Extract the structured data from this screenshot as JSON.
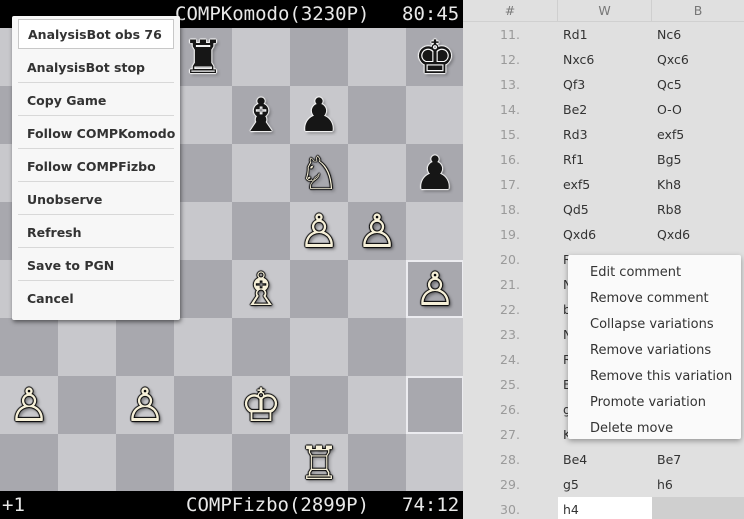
{
  "top_bar": {
    "left_text": "",
    "player": "COMPKomodo(3230P)",
    "clock": "80:45"
  },
  "bottom_bar": {
    "left_text": "+1",
    "player": "COMPFizbo(2899P)",
    "clock": "74:12"
  },
  "board": {
    "pieces": [
      {
        "sq": "d8",
        "glyph": "♜",
        "color": "b",
        "name": "black-rook"
      },
      {
        "sq": "h8",
        "glyph": "♚",
        "color": "b",
        "name": "black-king"
      },
      {
        "sq": "e7",
        "glyph": "♝",
        "color": "b",
        "name": "black-bishop"
      },
      {
        "sq": "f7",
        "glyph": "♟",
        "color": "b",
        "name": "black-pawn"
      },
      {
        "sq": "f6",
        "glyph": "♘",
        "color": "w",
        "name": "white-knight"
      },
      {
        "sq": "h6",
        "glyph": "♟",
        "color": "b",
        "name": "black-pawn"
      },
      {
        "sq": "f5",
        "glyph": "♙",
        "color": "w",
        "name": "white-pawn"
      },
      {
        "sq": "g5",
        "glyph": "♙",
        "color": "w",
        "name": "white-pawn"
      },
      {
        "sq": "e4",
        "glyph": "♗",
        "color": "w",
        "name": "white-bishop"
      },
      {
        "sq": "h4",
        "glyph": "♙",
        "color": "w",
        "name": "white-pawn"
      },
      {
        "sq": "a2",
        "glyph": "♙",
        "color": "w",
        "name": "white-pawn"
      },
      {
        "sq": "c2",
        "glyph": "♙",
        "color": "w",
        "name": "white-pawn"
      },
      {
        "sq": "e2",
        "glyph": "♔",
        "color": "w",
        "name": "white-king"
      },
      {
        "sq": "f1",
        "glyph": "♖",
        "color": "w",
        "name": "white-rook"
      }
    ],
    "highlighted": [
      "h4",
      "h2"
    ]
  },
  "board_menu": {
    "items": [
      "AnalysisBot obs 76",
      "AnalysisBot stop",
      "Copy Game",
      "Follow COMPKomodo",
      "Follow COMPFizbo",
      "Unobserve",
      "Refresh",
      "Save to PGN",
      "Cancel"
    ]
  },
  "move_list": {
    "headers": {
      "num": "#",
      "white": "W",
      "black": "B"
    },
    "rows": [
      {
        "n": "11.",
        "w": "Rd1",
        "b": "Nc6"
      },
      {
        "n": "12.",
        "w": "Nxc6",
        "b": "Qxc6"
      },
      {
        "n": "13.",
        "w": "Qf3",
        "b": "Qc5"
      },
      {
        "n": "14.",
        "w": "Be2",
        "b": "O-O"
      },
      {
        "n": "15.",
        "w": "Rd3",
        "b": "exf5"
      },
      {
        "n": "16.",
        "w": "Rf1",
        "b": "Bg5"
      },
      {
        "n": "17.",
        "w": "exf5",
        "b": "Kh8"
      },
      {
        "n": "18.",
        "w": "Qd5",
        "b": "Rb8"
      },
      {
        "n": "19.",
        "w": "Qxd6",
        "b": "Qxd6"
      },
      {
        "n": "20.",
        "w": "R",
        "b": ""
      },
      {
        "n": "21.",
        "w": "N",
        "b": ""
      },
      {
        "n": "22.",
        "w": "b",
        "b": ""
      },
      {
        "n": "23.",
        "w": "N",
        "b": ""
      },
      {
        "n": "24.",
        "w": "R",
        "b": ""
      },
      {
        "n": "25.",
        "w": "B",
        "b": ""
      },
      {
        "n": "26.",
        "w": "g",
        "b": ""
      },
      {
        "n": "27.",
        "w": "K",
        "b": ""
      },
      {
        "n": "28.",
        "w": "Be4",
        "b": "Be7"
      },
      {
        "n": "29.",
        "w": "g5",
        "b": "h6"
      },
      {
        "n": "30.",
        "w": "h4",
        "b": ""
      }
    ]
  },
  "context_menu": {
    "items": [
      "Edit comment",
      "Remove comment",
      "Collapse variations",
      "Remove variations",
      "Remove this variation",
      "Promote variation",
      "Delete move"
    ]
  },
  "colors": {
    "light_square": "#c8c8cc",
    "dark_square": "#a8a8ae",
    "panel_bg": "#e0e0e0",
    "menu_bg": "#f7f7f7"
  }
}
